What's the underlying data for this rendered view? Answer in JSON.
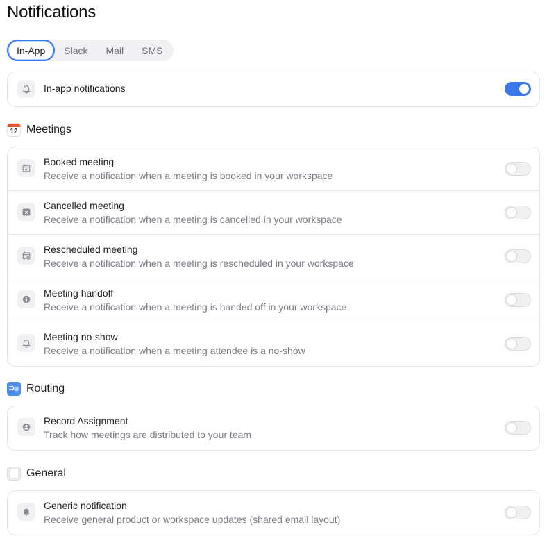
{
  "page": {
    "title": "Notifications"
  },
  "tabs": [
    {
      "label": "In-App",
      "active": true
    },
    {
      "label": "Slack",
      "active": false
    },
    {
      "label": "Mail",
      "active": false
    },
    {
      "label": "SMS",
      "active": false
    }
  ],
  "inapp": {
    "label": "In-app notifications",
    "enabled": true,
    "icon": "bell-icon"
  },
  "meetings": {
    "title": "Meetings",
    "icon_text": "12",
    "items": [
      {
        "title": "Booked meeting",
        "desc": "Receive a notification when a meeting is booked in your workspace",
        "icon": "calendar-check-icon",
        "enabled": false
      },
      {
        "title": "Cancelled meeting",
        "desc": "Receive a notification when a meeting is cancelled in your workspace",
        "icon": "calendar-x-icon",
        "enabled": false
      },
      {
        "title": "Rescheduled meeting",
        "desc": "Receive a notification when a meeting is rescheduled in your workspace",
        "icon": "calendar-clock-icon",
        "enabled": false
      },
      {
        "title": "Meeting handoff",
        "desc": "Receive a notification when a meeting is handed off in your workspace",
        "icon": "handoff-icon",
        "enabled": false
      },
      {
        "title": "Meeting no-show",
        "desc": "Receive a notification when a meeting attendee is a no-show",
        "icon": "bell-icon",
        "enabled": false
      }
    ]
  },
  "routing": {
    "title": "Routing",
    "items": [
      {
        "title": "Record Assignment",
        "desc": "Track how meetings are distributed to your team",
        "icon": "user-circle-icon",
        "enabled": false
      }
    ]
  },
  "general": {
    "title": "General",
    "items": [
      {
        "title": "Generic notification",
        "desc": "Receive general product or workspace updates (shared email layout)",
        "icon": "bell-filled-icon",
        "enabled": false
      }
    ]
  },
  "colors": {
    "accent": "#3b78e7",
    "calendar_red": "#e8562f",
    "routing_blue": "#4d8fe6"
  }
}
